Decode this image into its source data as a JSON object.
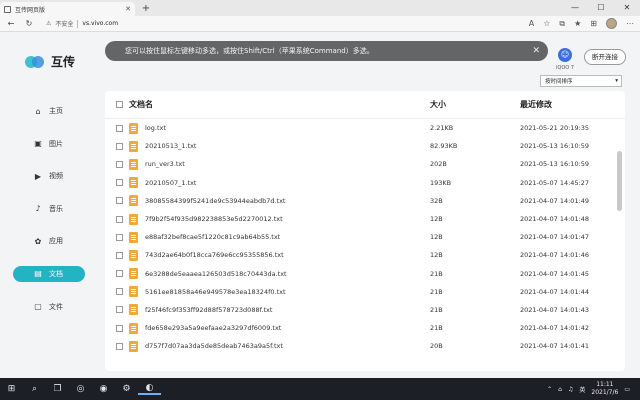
{
  "browser": {
    "tab_title": "互传网页版",
    "security_label": "不安全",
    "url": "vs.vivo.com"
  },
  "app": {
    "logo_text": "互传",
    "nav": [
      {
        "label": "主页",
        "icon": "home-icon",
        "glyph": "⌂",
        "active": false
      },
      {
        "label": "图片",
        "icon": "image-icon",
        "glyph": "▣",
        "active": false
      },
      {
        "label": "视频",
        "icon": "video-icon",
        "glyph": "▶",
        "active": false
      },
      {
        "label": "音乐",
        "icon": "music-icon",
        "glyph": "♪",
        "active": false
      },
      {
        "label": "应用",
        "icon": "apps-icon",
        "glyph": "✿",
        "active": false
      },
      {
        "label": "文档",
        "icon": "document-icon",
        "glyph": "▤",
        "active": true
      },
      {
        "label": "文件",
        "icon": "folder-icon",
        "glyph": "▢",
        "active": false
      }
    ],
    "toast": "您可以按住鼠标左键移动多选，或按住Shift/Ctrl（苹果系统Command）多选。",
    "device_name": "iQOO 7",
    "disconnect_label": "断开连接",
    "sort_label": "按时间排序"
  },
  "table": {
    "headers": {
      "name": "文档名",
      "size": "大小",
      "modified": "最近修改"
    },
    "rows": [
      {
        "name": "log.txt",
        "size": "2.21KB",
        "modified": "2021-05-21 20:19:35"
      },
      {
        "name": "20210513_1.txt",
        "size": "82.93KB",
        "modified": "2021-05-13 16:10:59"
      },
      {
        "name": "run_ver3.txt",
        "size": "202B",
        "modified": "2021-05-13 16:10:59"
      },
      {
        "name": "20210507_1.txt",
        "size": "193KB",
        "modified": "2021-05-07 14:45:27"
      },
      {
        "name": "38085584399f5241de9c53944eabdb7d.txt",
        "size": "32B",
        "modified": "2021-04-07 14:01:49"
      },
      {
        "name": "7f9b2f54f935d982238853e5d2270012.txt",
        "size": "12B",
        "modified": "2021-04-07 14:01:48"
      },
      {
        "name": "e88af32bef8cae5f1220c81c9ab64b55.txt",
        "size": "12B",
        "modified": "2021-04-07 14:01:47"
      },
      {
        "name": "743d2ae64b0f18cca769e6cc95355856.txt",
        "size": "12B",
        "modified": "2021-04-07 14:01:46"
      },
      {
        "name": "6e3288de5eaaea126503d518c70443da.txt",
        "size": "21B",
        "modified": "2021-04-07 14:01:45"
      },
      {
        "name": "5161ee81858a46e949578e3ea18324f0.txt",
        "size": "21B",
        "modified": "2021-04-07 14:01:44"
      },
      {
        "name": "f25f46fc9f353ff92d88f578723d088f.txt",
        "size": "21B",
        "modified": "2021-04-07 14:01:43"
      },
      {
        "name": "fde658e293a5a9eefaae2a3297df6009.txt",
        "size": "21B",
        "modified": "2021-04-07 14:01:42"
      },
      {
        "name": "d757f7d07aa3da5de85deab7463a9a5f.txt",
        "size": "20B",
        "modified": "2021-04-07 14:01:41"
      }
    ]
  },
  "taskbar": {
    "time": "11:11",
    "date": "2021/7/6"
  }
}
